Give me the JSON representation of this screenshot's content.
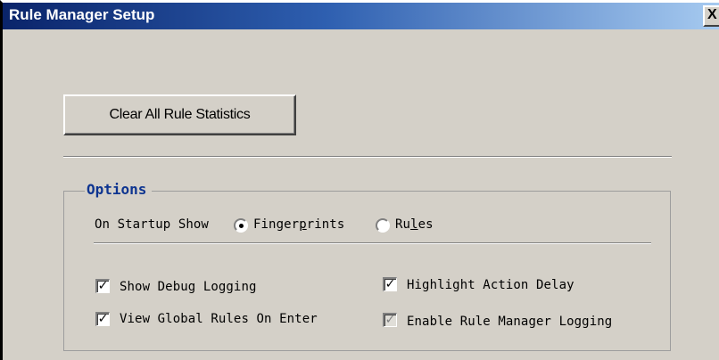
{
  "window": {
    "title": "Rule Manager Setup",
    "close_glyph": "X"
  },
  "actions": {
    "clear_stats_label": "Clear All Rule Statistics"
  },
  "options": {
    "group_label": "Options",
    "startup_label": "On Startup Show",
    "startup_choices": [
      {
        "pre": "Finger",
        "accel": "p",
        "post": "rints",
        "selected": true
      },
      {
        "pre": "Ru",
        "accel": "l",
        "post": "es",
        "selected": false
      }
    ],
    "checkboxes": [
      {
        "label": "Show Debug Logging",
        "checked": true,
        "enabled": true
      },
      {
        "label": "View Global Rules On Enter",
        "checked": true,
        "enabled": true
      },
      {
        "label": "Highlight Action Delay",
        "checked": true,
        "enabled": true
      },
      {
        "label": "Enable Rule Manager Logging",
        "checked": true,
        "enabled": false
      }
    ],
    "check_glyph": "✓"
  },
  "colors": {
    "titlebar_start": "#0a246a",
    "titlebar_end": "#a6caf0",
    "dialog_face": "#d4d0c8",
    "group_label": "#0d3490"
  }
}
